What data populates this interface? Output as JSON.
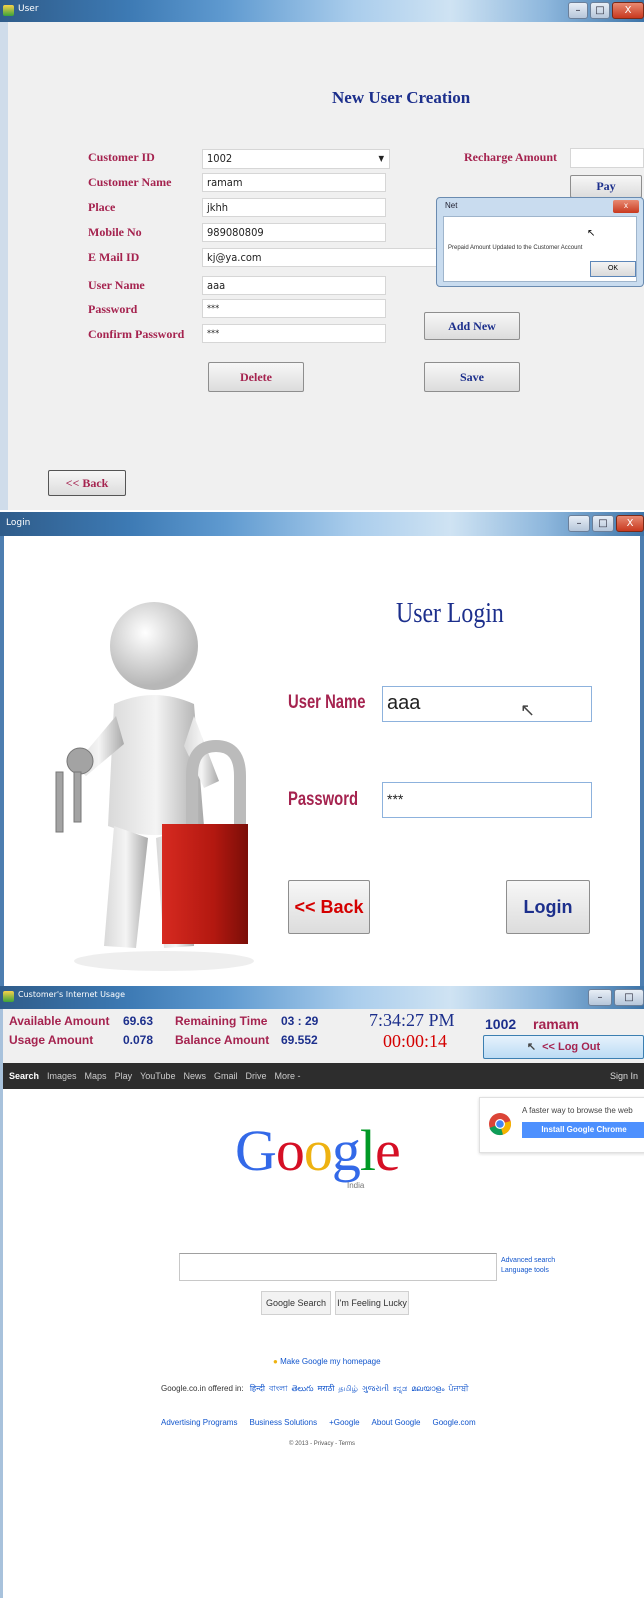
{
  "window1": {
    "title": "User",
    "controls": {
      "minimize": "–",
      "maximize": "□",
      "close": "X"
    },
    "heading": "New User Creation",
    "labels": {
      "customer_id": "Customer ID",
      "customer_name": "Customer Name",
      "place": "Place",
      "mobile_no": "Mobile No",
      "email_id": "E Mail ID",
      "user_name": "User Name",
      "password": "Password",
      "confirm_password": "Confirm Password",
      "recharge_amount": "Recharge Amount"
    },
    "values": {
      "customer_id": "1002",
      "customer_name": "ramam",
      "place": "jkhh",
      "mobile_no": "989080809",
      "email_id": "kj@ya.com",
      "user_name": "aaa",
      "password": "***",
      "confirm_password": "***",
      "recharge_amount": ""
    },
    "buttons": {
      "pay": "Pay",
      "add_new": "Add New",
      "delete": "Delete",
      "save": "Save",
      "back": "<< Back"
    },
    "dialog": {
      "title": "Net",
      "message": "Prepaid Amount Updated to the Customer Account",
      "ok": "OK"
    }
  },
  "window2": {
    "title": "Login",
    "controls": {
      "minimize": "–",
      "maximize": "□",
      "close": "X"
    },
    "heading": "User Login",
    "labels": {
      "user_name": "User Name",
      "password": "Password"
    },
    "values": {
      "user_name": "aaa",
      "password": "***"
    },
    "buttons": {
      "back": "<< Back",
      "login": "Login"
    }
  },
  "window3": {
    "title": "Customer's Internet Usage",
    "controls": {
      "minimize": "–",
      "maximize": "□"
    },
    "stats": {
      "available_label": "Available Amount",
      "available_value": "69.63",
      "remaining_label": "Remaining Time",
      "remaining_value": "03 : 29",
      "usage_label": "Usage Amount",
      "usage_value": "0.078",
      "balance_label": "Balance Amount",
      "balance_value": "69.552",
      "clock": "7:34:27 PM",
      "elapsed": "00:00:14",
      "customer_id": "1002",
      "customer_name": "ramam",
      "logout": "<< Log Out"
    },
    "google": {
      "nav": [
        "Search",
        "Images",
        "Maps",
        "Play",
        "YouTube",
        "News",
        "Gmail",
        "Drive",
        "More -"
      ],
      "signin": "Sign In",
      "chrome_promo": "A faster way to browse the web",
      "chrome_button": "Install Google Chrome",
      "logo": "Google",
      "logo_sub": "India",
      "advanced_search": "Advanced search",
      "language_tools": "Language tools",
      "search_button": "Google Search",
      "lucky_button": "I'm Feeling Lucky",
      "homepage_link": "Make Google my homepage",
      "offered_in": "Google.co.in offered in:",
      "languages": [
        "हिन्दी",
        "বাংলা",
        "తెలుగు",
        "मराठी",
        "தமிழ்",
        "ગુજરાતી",
        "ಕನ್ನಡ",
        "മലയാളം",
        "ਪੰਜਾਬੀ"
      ],
      "footer_links": [
        "Advertising Programs",
        "Business Solutions",
        "+Google",
        "About Google",
        "Google.com"
      ],
      "copyright": "© 2013 - Privacy - Terms"
    },
    "colors": {
      "label_red": "#a5234f",
      "value_blue": "#1c2f8c",
      "clock_blue": "#1c2f8c",
      "elapsed_red": "#d40000"
    }
  }
}
